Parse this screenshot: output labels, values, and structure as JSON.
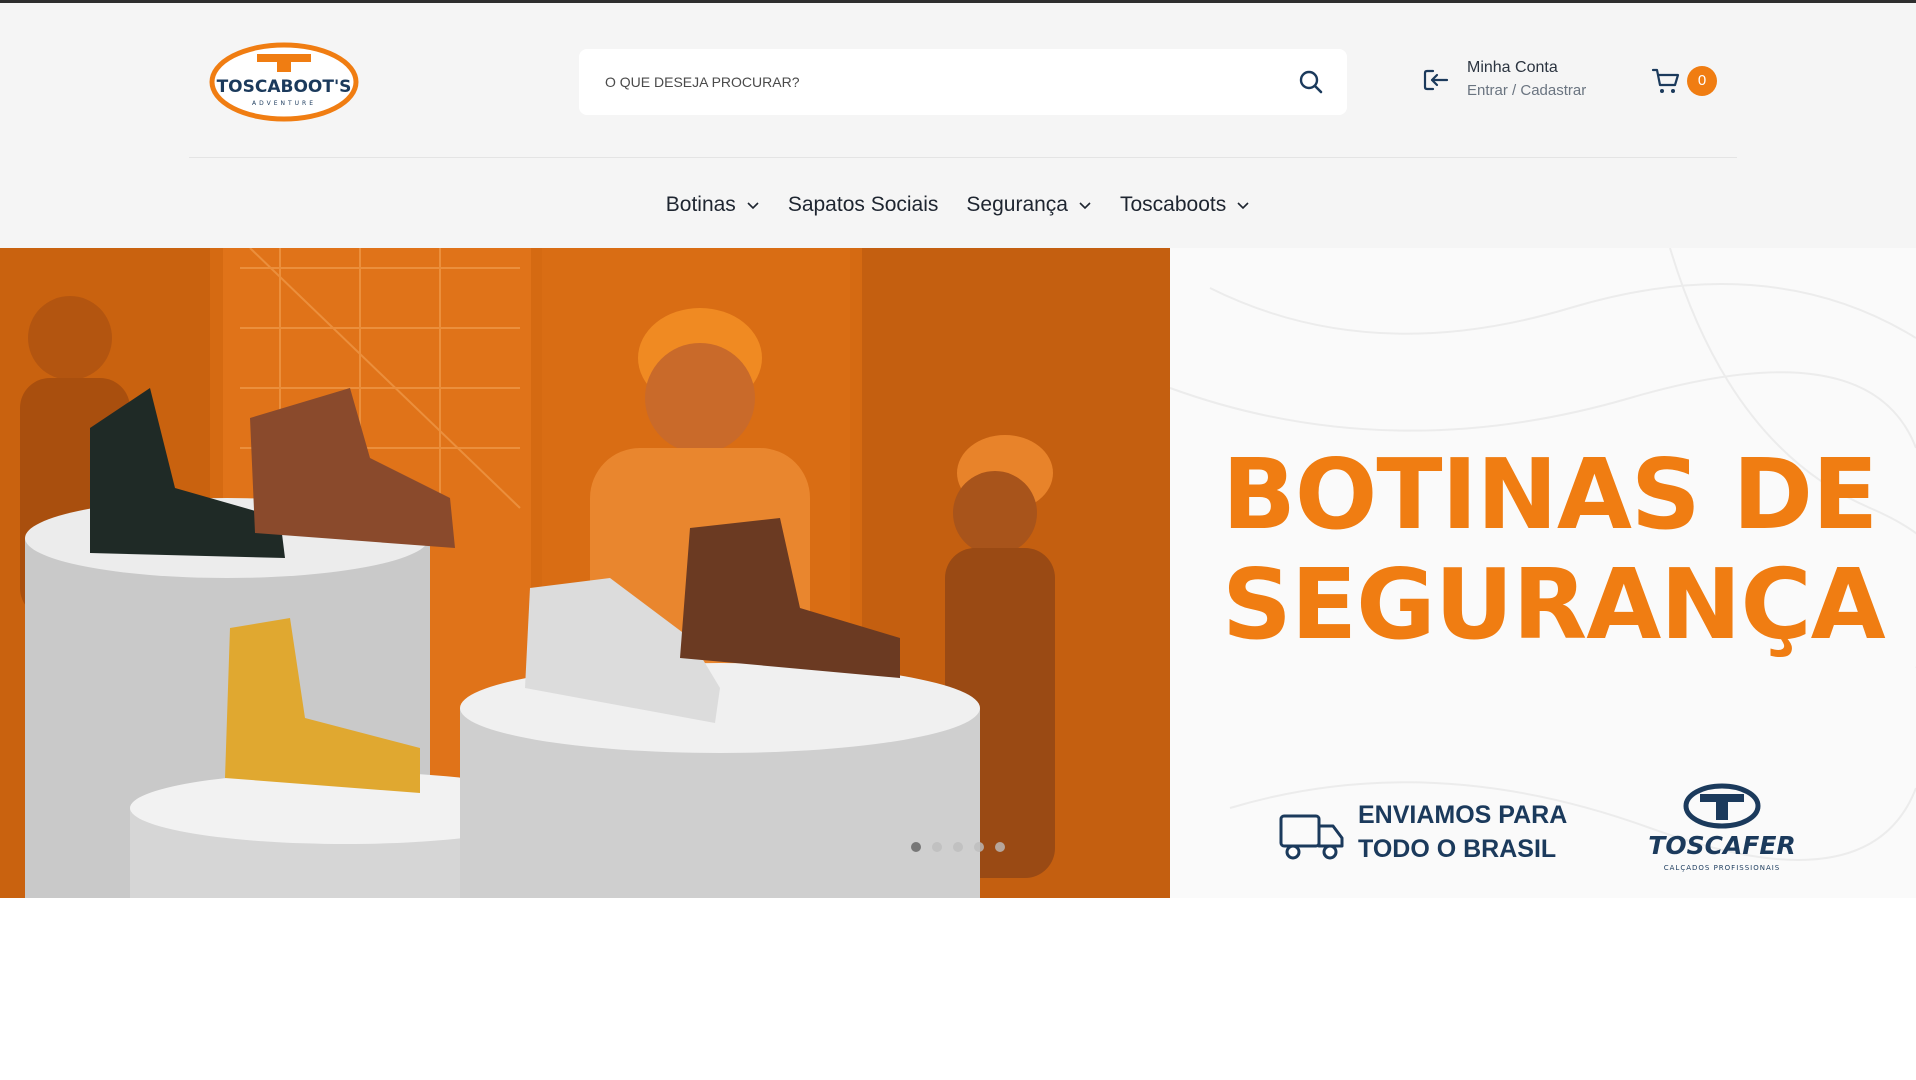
{
  "header": {
    "logo": {
      "text": "TOSCABOOT'S",
      "subtitle": "ADVENTURE"
    },
    "search": {
      "placeholder": "O QUE DESEJA PROCURAR?"
    },
    "account": {
      "title": "Minha Conta",
      "login": "Entrar",
      "separator": "/",
      "register": "Cadastrar"
    },
    "cart": {
      "count": "0"
    }
  },
  "nav": {
    "items": [
      {
        "label": "Botinas",
        "has_dropdown": true
      },
      {
        "label": "Sapatos Sociais",
        "has_dropdown": false
      },
      {
        "label": "Segurança",
        "has_dropdown": true
      },
      {
        "label": "Toscaboots",
        "has_dropdown": true
      }
    ]
  },
  "hero": {
    "headline_line1": "BOTINAS DE",
    "headline_line2": "SEGURANÇA",
    "shipping_line1": "ENVIAMOS PARA",
    "shipping_line2": "TODO O BRASIL",
    "brand_name": "TOSCAFER",
    "brand_tagline": "CALÇADOS PROFISSIONAIS",
    "slides": 5,
    "active_slide": 1
  },
  "colors": {
    "accent": "#f07d12",
    "navy": "#1b3a5c",
    "text": "#1e2530",
    "header_bg": "#f5f5f5"
  }
}
